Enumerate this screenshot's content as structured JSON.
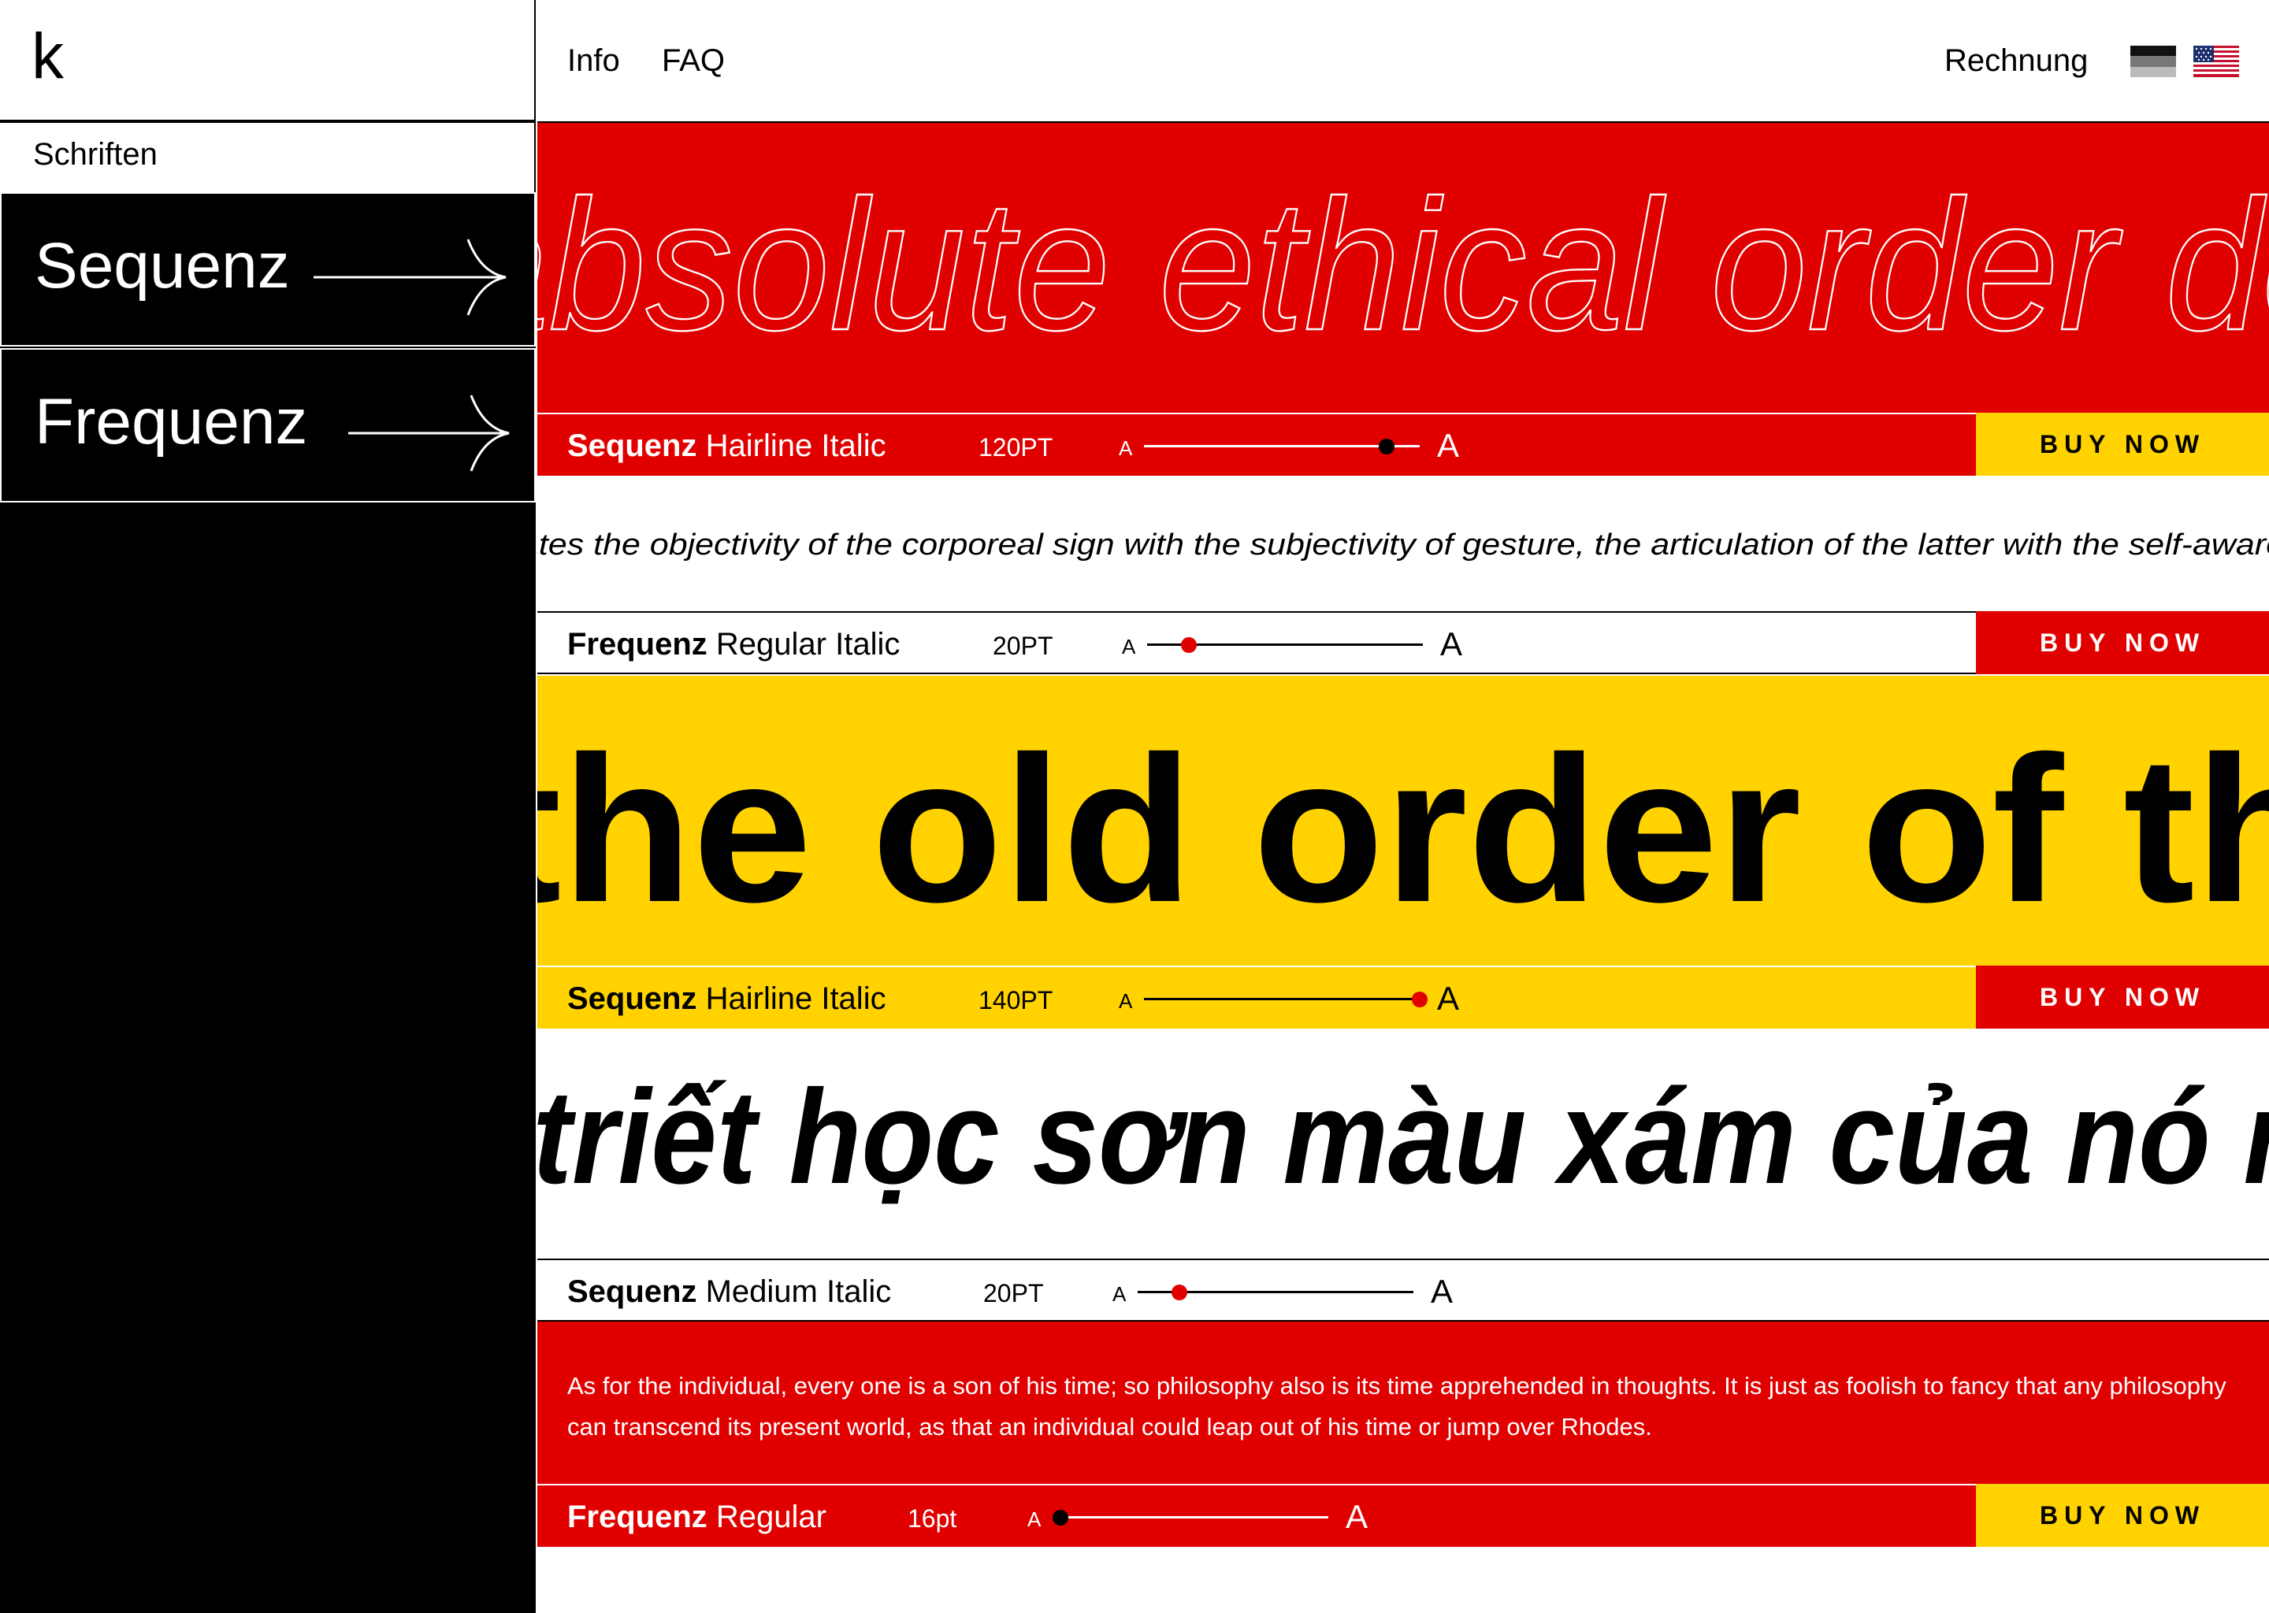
{
  "logo": "k",
  "sidebar": {
    "section_label": "Schriften",
    "items": [
      {
        "label": "Sequenz"
      },
      {
        "label": "Frequenz"
      }
    ]
  },
  "header": {
    "nav": [
      {
        "label": "Info"
      },
      {
        "label": "FAQ"
      }
    ],
    "invoice_label": "Rechnung",
    "languages": [
      {
        "name": "german-flag-icon"
      },
      {
        "name": "us-flag-icon"
      }
    ]
  },
  "specimens": [
    {
      "text": "absolute ethical order de",
      "family": "Sequenz",
      "style": "Hairline Italic",
      "size": "120PT",
      "size_level": 0.88,
      "buy_label": "BUY NOW",
      "colors": {
        "hero_bg": "#e10000",
        "hero_text": "#ffffff",
        "bar_bg": "#e10000",
        "bar_text": "#ffffff",
        "buy_bg": "#ffd200",
        "buy_text": "#000000",
        "knob": "#000000"
      }
    },
    {
      "text": "ates the objectivity of the corporeal sign with the subjectivity of gesture, the articulation of the latter with the self-aware",
      "family": "Frequenz",
      "style": "Regular Italic",
      "size": "20PT",
      "size_level": 0.15,
      "buy_label": "BUY NOW",
      "colors": {
        "hero_bg": "#ffffff",
        "hero_text": "#000000",
        "bar_bg": "#ffffff",
        "bar_text": "#000000",
        "buy_bg": "#e10000",
        "buy_text": "#ffffff",
        "knob": "#e10000"
      }
    },
    {
      "text": "the old order of th",
      "family": "Sequenz",
      "style": "Hairline Italic",
      "size": "140PT",
      "size_level": 1.0,
      "buy_label": "BUY NOW",
      "colors": {
        "hero_bg": "#ffd200",
        "hero_text": "#000000",
        "bar_bg": "#ffd200",
        "bar_text": "#000000",
        "buy_bg": "#e10000",
        "buy_text": "#ffffff",
        "knob": "#e10000"
      }
    },
    {
      "text": "triết học sơn màu xám của nó r",
      "family": "Sequenz",
      "style": "Medium Italic",
      "size": "20PT",
      "size_level": 0.15,
      "buy_label": "",
      "colors": {
        "hero_bg": "#ffffff",
        "hero_text": "#000000",
        "bar_bg": "#ffffff",
        "bar_text": "#000000",
        "buy_bg": "#ffffff",
        "buy_text": "#000000",
        "knob": "#e10000"
      }
    },
    {
      "text": "As for the individual, every one is a son of his time; so philosophy also is its time apprehended in thoughts. It is just as foolish to fancy that any philosophy can transcend its present world, as that an individual could leap out of his time or jump over Rhodes.",
      "family": "Frequenz",
      "style": "Regular",
      "size": "16pt",
      "size_level": 0.0,
      "buy_label": "BUY NOW",
      "colors": {
        "hero_bg": "#e10000",
        "hero_text": "#ffffff",
        "bar_bg": "#e10000",
        "bar_text": "#ffffff",
        "buy_bg": "#ffd200",
        "buy_text": "#000000",
        "knob": "#000000"
      }
    }
  ]
}
